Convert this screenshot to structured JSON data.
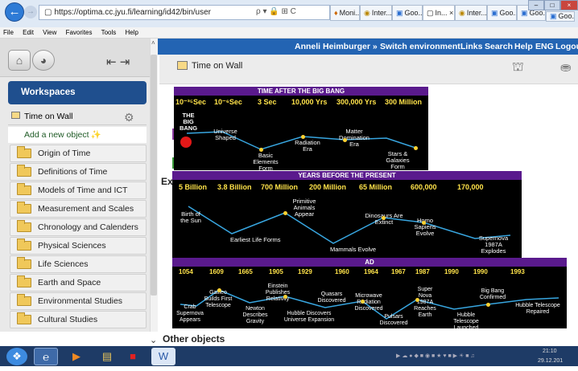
{
  "browser": {
    "url": "https://optima.cc.jyu.fi/learning/id42/bin/user",
    "addr_controls": "ρ ▾ 🔒 ⊞ C",
    "tabs": [
      {
        "label": "Moni..."
      },
      {
        "label": "Inter..."
      },
      {
        "label": "Goo..."
      },
      {
        "label": "In... ×"
      },
      {
        "label": "Inter..."
      },
      {
        "label": "Goo..."
      },
      {
        "label": "Goo..."
      },
      {
        "label": "Goo..."
      }
    ],
    "menu": [
      "File",
      "Edit",
      "View",
      "Favorites",
      "Tools",
      "Help"
    ]
  },
  "topbar": {
    "user": "Anneli Heimburger »",
    "switch": "Switch environment",
    "links": "Links",
    "search": "Search",
    "help": "Help",
    "lang": "ENG",
    "logout": "Logou"
  },
  "sidebar": {
    "workspaces_label": "Workspaces",
    "time_on_wall": "Time on Wall",
    "add_object": "Add a new object",
    "folders": [
      "Origin of Time",
      "Definitions of Time",
      "Models of Time and ICT",
      "Measurement and Scales",
      "Chronology and Calenders",
      "Physical Sciences",
      "Life Sciences",
      "Earth and Space",
      "Environmental Studies",
      "Cultural Studies"
    ]
  },
  "main": {
    "title": "Time on Wall",
    "partial_heading": "Ex",
    "other_objects": "Other objects"
  },
  "timeline": {
    "band1": {
      "title": "TIME AFTER THE BIG BANG",
      "ticks": [
        "10⁻³⁵Sec",
        "10⁻⁶Sec",
        "3 Sec",
        "10,000 Yrs",
        "300,000 Yrs",
        "300 Million"
      ],
      "events": [
        "THE BIG BANG",
        "Universe Shaped",
        "Basic Elements Form",
        "Radiation Era",
        "Matter Domination Era",
        "Stars & Galaxies Form"
      ]
    },
    "band2": {
      "title": "YEARS BEFORE THE PRESENT",
      "ticks": [
        "5 Billion",
        "3.8 Billion",
        "700 Million",
        "200 Million",
        "65 Million",
        "600,000",
        "170,000"
      ],
      "events": [
        "Birth of the Sun",
        "Earliest Life Forms",
        "Primitive Animals Appear",
        "Mammals Evolve",
        "Dinosaurs Are Extinct",
        "Homo Sapiens Evolve",
        "Supernova 1987A Explodes"
      ]
    },
    "band3": {
      "title": "AD",
      "ticks": [
        "1054",
        "1609",
        "1665",
        "1905",
        "1929",
        "1960",
        "1964",
        "1967",
        "1987",
        "1990",
        "1990",
        "1993"
      ],
      "events": [
        "Crab Supernova Appears",
        "Galileo Builds First Telescope",
        "Newton Describes Gravity",
        "Einstein Publishes Relativity",
        "Hubble Discovers Universe Expansion",
        "Quasars Discovered",
        "Microwave Radiation Discovered",
        "Pulsars Discovered",
        "Super Nova 1987A Reaches Earth",
        "Hubble Telescope Launched",
        "Big Bang Confirmed",
        "Hubble Telescope Repaired"
      ]
    }
  },
  "tray": {
    "time": "21:10",
    "date": "29.12.201"
  }
}
